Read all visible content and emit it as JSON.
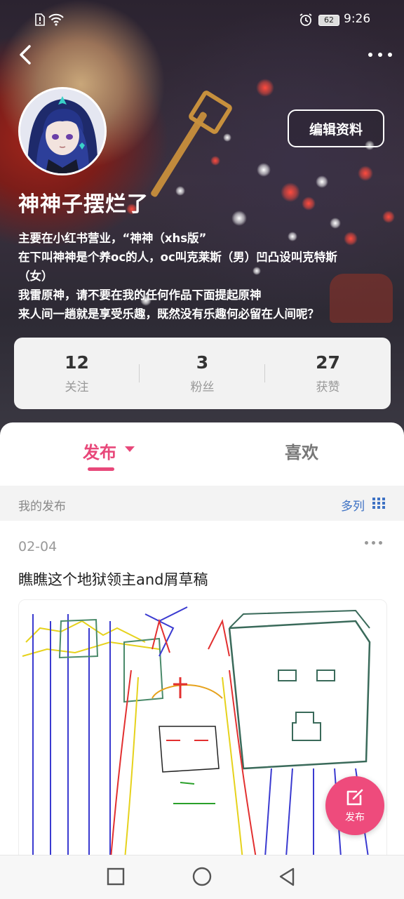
{
  "status_bar": {
    "battery": "62",
    "time": "9:26",
    "icons": [
      "sim-alert-icon",
      "wifi-icon",
      "alarm-icon",
      "battery-icon"
    ]
  },
  "profile": {
    "nickname": "神神子摆烂了",
    "edit_button": "编辑资料",
    "bio": [
      "主要在小红书营业，“神神（xhs版”",
      "在下叫神神是个养oc的人，oc叫克莱斯（男）凹凸设叫克特斯",
      "（女）",
      "我雷原神，请不要在我的任何作品下面提起原神",
      "来人间一趟就是享受乐趣，既然没有乐趣何必留在人间呢？"
    ]
  },
  "stats": [
    {
      "value": "12",
      "label": "关注"
    },
    {
      "value": "3",
      "label": "粉丝"
    },
    {
      "value": "27",
      "label": "获赞"
    }
  ],
  "tabs": {
    "publish": "发布",
    "like": "喜欢"
  },
  "subbar": {
    "my_posts": "我的发布",
    "columns": "多列"
  },
  "post": {
    "date": "02-04",
    "title": "瞧瞧这个地狱领主and屑草稿"
  },
  "fab": {
    "label": "发布",
    "icon": "edit-icon"
  },
  "colors": {
    "accent": "#e8487a",
    "fab": "#ee4b7c",
    "link": "#3e72c4"
  }
}
